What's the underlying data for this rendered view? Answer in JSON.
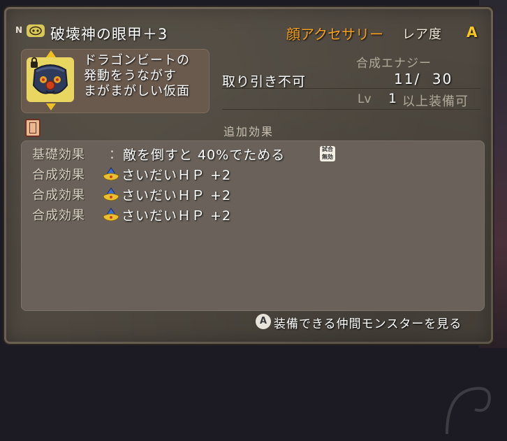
{
  "header": {
    "badge": "N",
    "item_name": "破壊神の眼甲＋3",
    "category": "顔アクセサリー",
    "rarity_label": "レア度",
    "rarity_grade": "A"
  },
  "item": {
    "description": [
      "ドラゴンビートの",
      "発動をうながす",
      "まがまがしい仮面"
    ],
    "trade": "取り引き不可",
    "energy_label": "合成エナジー",
    "energy_value": "11/  30",
    "lv_label": "Lv",
    "lv_value": "1",
    "lv_suffix": "以上装備可"
  },
  "effects": {
    "title": "追加効果",
    "rows": [
      {
        "label": "基礎効果",
        "colon": "：",
        "value": "敵を倒すと 40%でためる",
        "badge": [
          "試合",
          "無効"
        ]
      },
      {
        "label": "合成効果",
        "value": "さいだいＨＰ +2"
      },
      {
        "label": "合成効果",
        "value": "さいだいＨＰ +2"
      },
      {
        "label": "合成効果",
        "value": "さいだいＨＰ +2"
      }
    ]
  },
  "footer": {
    "button": "A",
    "text": "装備できる仲間モンスターを見る"
  },
  "colors": {
    "category": "#f4a020",
    "rarity": "#f8c820",
    "panel": "#4e4840"
  },
  "icons": [
    "mask-icon",
    "lock-icon",
    "book-icon",
    "synthesis-gem-icon",
    "a-button-icon"
  ]
}
